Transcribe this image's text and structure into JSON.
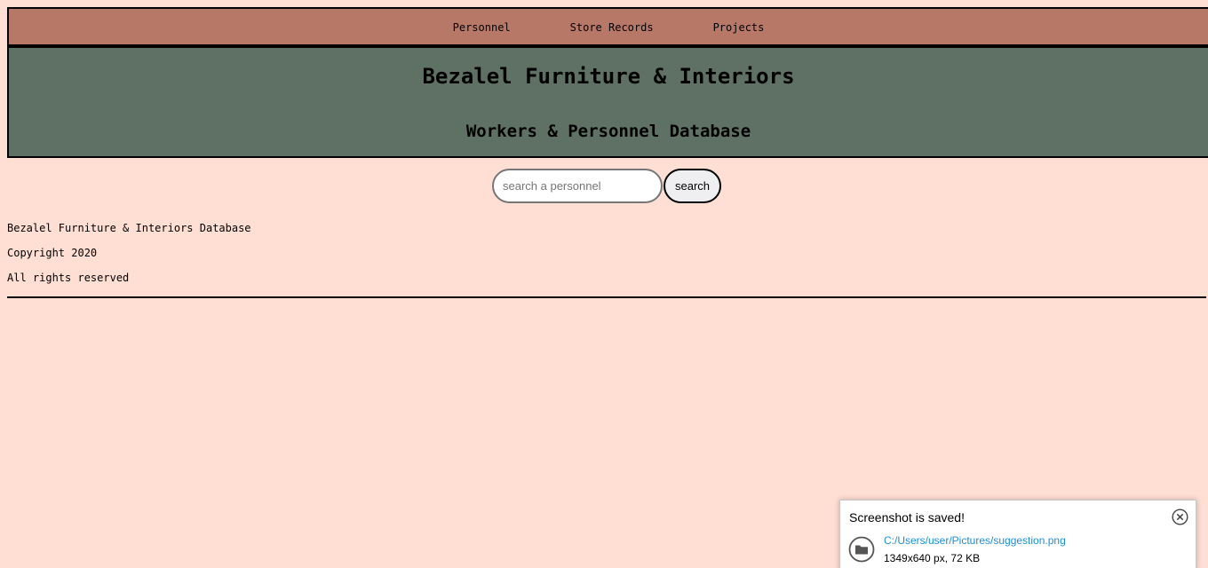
{
  "nav": {
    "items": [
      {
        "label": "Personnel"
      },
      {
        "label": "Store Records"
      },
      {
        "label": "Projects"
      }
    ]
  },
  "header": {
    "title": "Bezalel Furniture & Interiors",
    "subtitle": "Workers & Personnel Database"
  },
  "search": {
    "placeholder": "search a personnel",
    "value": "",
    "button_label": "search"
  },
  "footer": {
    "lines": [
      "Bezalel Furniture & Interiors Database",
      "Copyright 2020",
      "All rights reserved"
    ]
  },
  "toast": {
    "title": "Screenshot is saved!",
    "path": "C:/Users/user/Pictures/suggestion.png",
    "meta": "1349x640 px, 72 KB",
    "icons": {
      "close": "close-circle-icon",
      "folder": "folder-icon"
    }
  },
  "colors": {
    "background": "#ffdfd3",
    "nav": "#b87867",
    "header": "#5e7164",
    "link": "#1a8fd4"
  }
}
